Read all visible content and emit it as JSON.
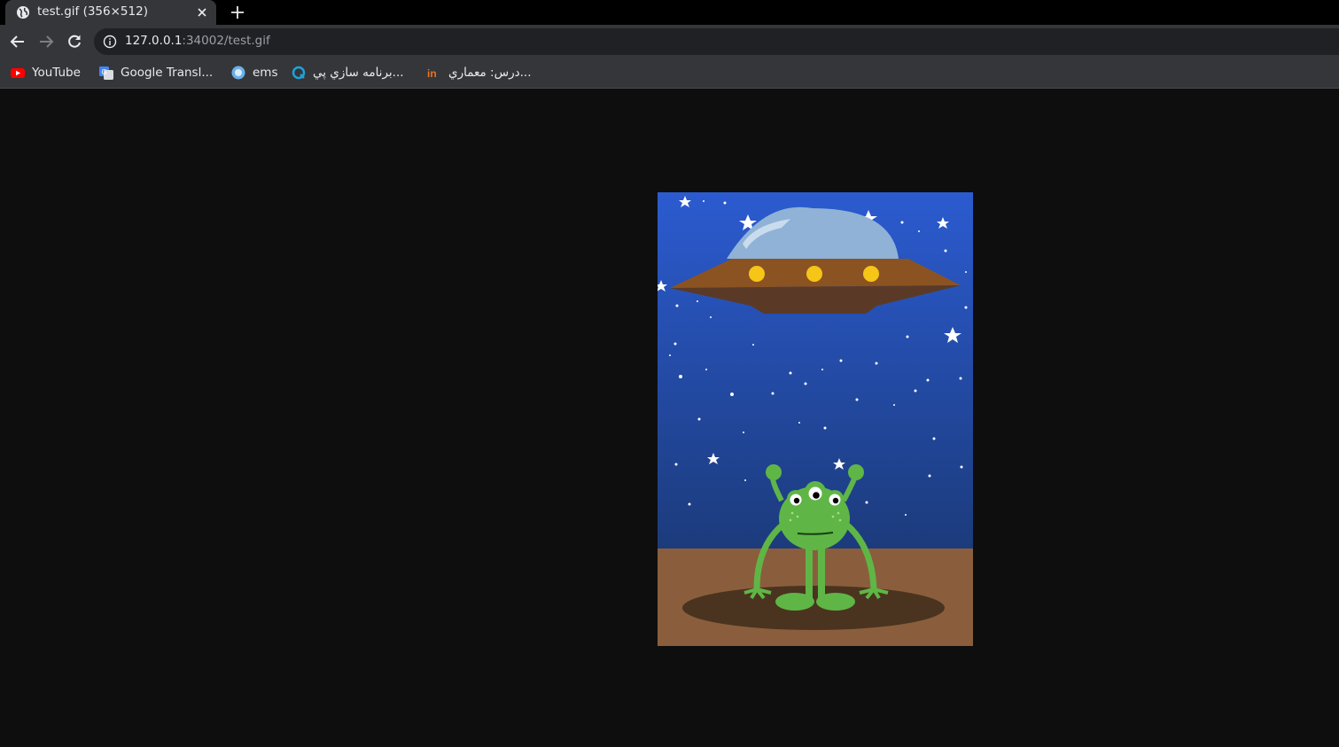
{
  "tab": {
    "title": "test.gif (356×512)",
    "favicon": "globe-icon"
  },
  "address_bar": {
    "host": "127.0.0.1",
    "path": ":34002/test.gif"
  },
  "bookmarks": [
    {
      "label": "YouTube",
      "icon": "youtube-icon"
    },
    {
      "label": "Google Transl...",
      "icon": "google-translate-icon"
    },
    {
      "label": "ems",
      "icon": "ems-icon"
    },
    {
      "label": "برنامه سازي پي...",
      "icon": "q-icon"
    },
    {
      "label": "درس: معماري...",
      "icon": "in-icon"
    }
  ],
  "image": {
    "description_icon": "alien-ufo-gif",
    "colors": {
      "sky_top": "#2b5bd0",
      "sky_bottom": "#1c3b7c",
      "ground": "#8a5e3c",
      "shadow": "#4a3420",
      "alien": "#5fb646",
      "ufo_body": "#8b5322",
      "ufo_dome": "#8fb2d6",
      "lights": "#f5c518"
    }
  }
}
